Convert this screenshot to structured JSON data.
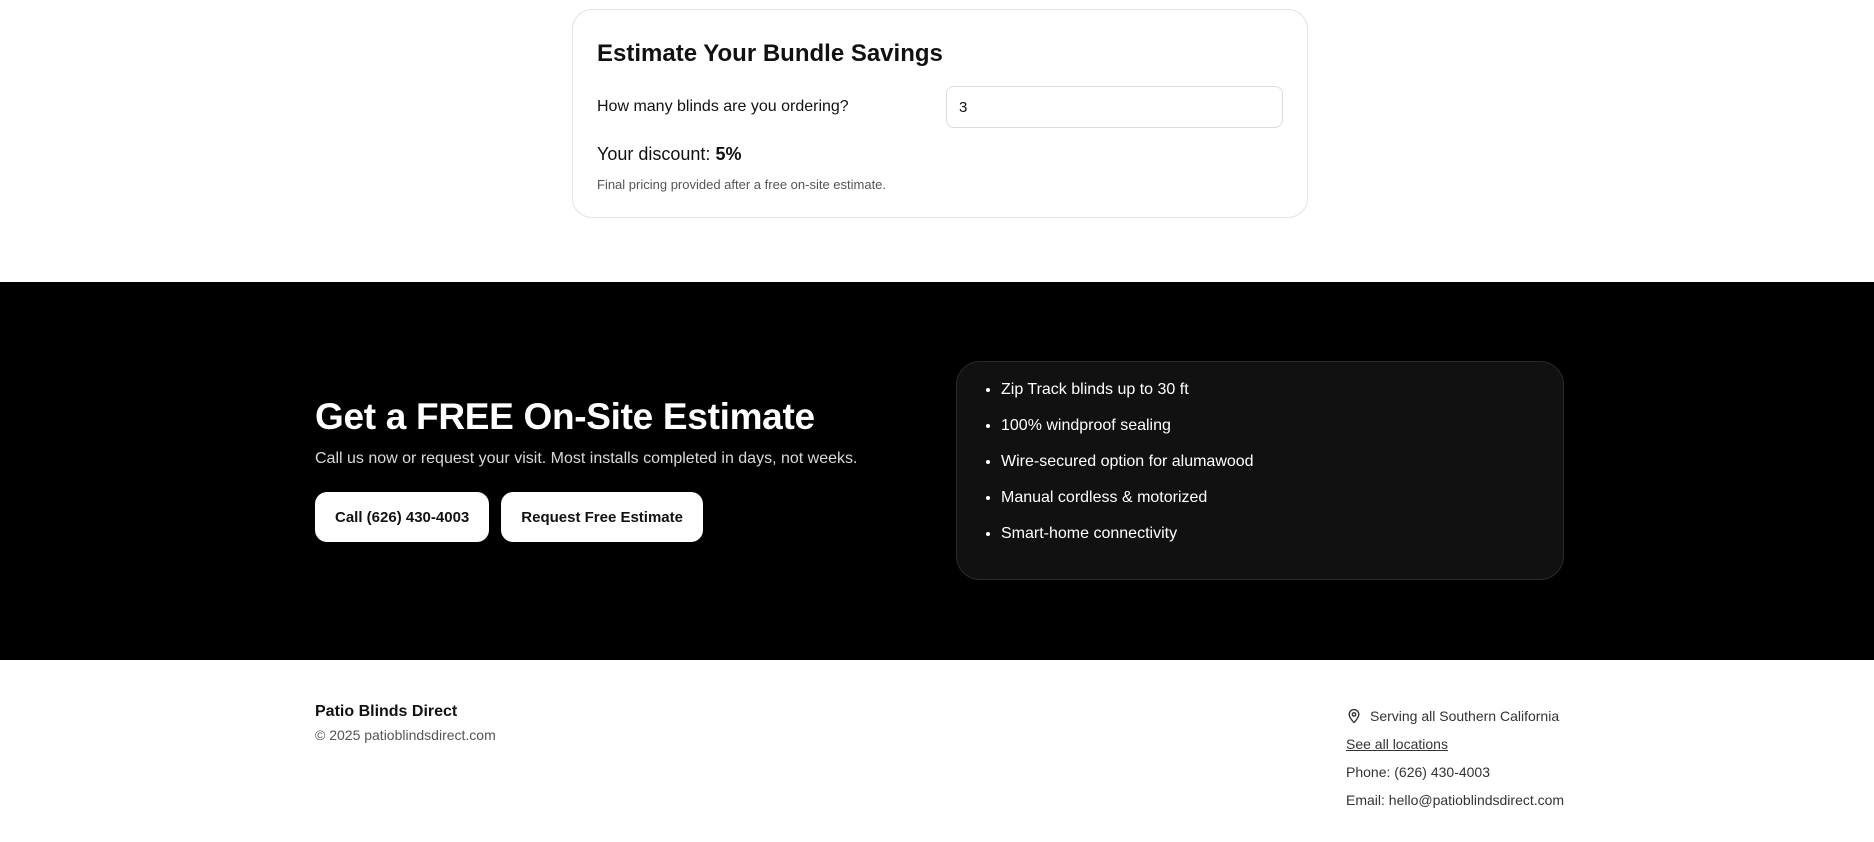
{
  "savings": {
    "title": "Estimate Your Bundle Savings",
    "qty_label": "How many blinds are you ordering?",
    "qty_value": "3",
    "discount_prefix": "Your discount:",
    "discount_value": "5%",
    "fine_print": "Final pricing provided after a free on-site estimate."
  },
  "cta": {
    "title": "Get a FREE On-Site Estimate",
    "subtitle": "Call us now or request your visit. Most installs completed in days, not weeks.",
    "call_button": "Call (626) 430-4003",
    "request_button": "Request Free Estimate",
    "features": [
      "Zip Track blinds up to 30 ft",
      "100% windproof sealing",
      "Wire-secured option for alumawood",
      "Manual cordless & motorized",
      "Smart-home connectivity"
    ]
  },
  "footer": {
    "brand": "Patio Blinds Direct",
    "copyright": "© 2025 patioblindsdirect.com",
    "service_area": "Serving all Southern California",
    "service_icon": "map-pin-icon",
    "locations_link": "See all locations",
    "phone": "Phone: (626) 430-4003",
    "email": "Email: hello@patioblindsdirect.com"
  },
  "colors": {
    "cta_background": "#000000",
    "feature_card_background": "#111111",
    "button_background": "#ffffff"
  }
}
